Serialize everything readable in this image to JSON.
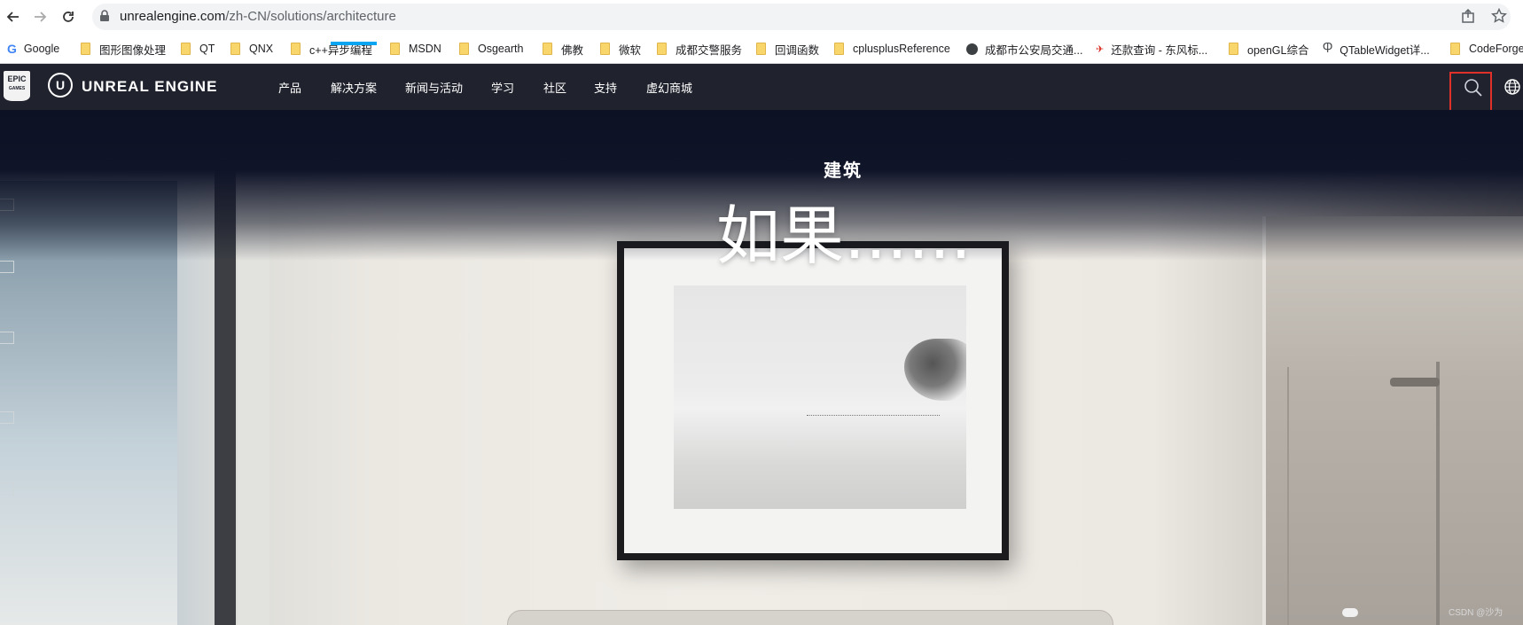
{
  "browser": {
    "url_host": "unrealengine.com",
    "url_path": "/zh-CN/solutions/architecture",
    "bookmarks": [
      {
        "label": "Google",
        "icon": "google-icon"
      },
      {
        "label": "图形图像处理",
        "icon": "folder-icon"
      },
      {
        "label": "QT",
        "icon": "folder-icon"
      },
      {
        "label": "QNX",
        "icon": "folder-icon"
      },
      {
        "label": "c++异步编程",
        "icon": "folder-icon"
      },
      {
        "label": "MSDN",
        "icon": "folder-icon"
      },
      {
        "label": "Osgearth",
        "icon": "folder-icon"
      },
      {
        "label": "佛教",
        "icon": "folder-icon"
      },
      {
        "label": "微软",
        "icon": "folder-icon"
      },
      {
        "label": "成都交警服务",
        "icon": "folder-icon"
      },
      {
        "label": "回调函数",
        "icon": "folder-icon"
      },
      {
        "label": "cplusplusReference",
        "icon": "folder-icon"
      },
      {
        "label": "成都市公安局交通...",
        "icon": "globe-icon"
      },
      {
        "label": "还款查询 - 东风标...",
        "icon": "brand-icon"
      },
      {
        "label": "openGL综合",
        "icon": "folder-icon"
      },
      {
        "label": "QTableWidget详...",
        "icon": "q-icon"
      },
      {
        "label": "CodeForge",
        "icon": "folder-icon"
      }
    ]
  },
  "site": {
    "epic_logo_text": "EPIC",
    "epic_logo_sub": "GAMES",
    "ue_logo_letter": "U",
    "brand": "UNREAL ENGINE",
    "nav": [
      {
        "label": "产品"
      },
      {
        "label": "解决方案"
      },
      {
        "label": "新闻与活动"
      },
      {
        "label": "学习"
      },
      {
        "label": "社区"
      },
      {
        "label": "支持"
      },
      {
        "label": "虚幻商城"
      }
    ],
    "active_nav": "解决方案",
    "accent_color": "#0aa5f0",
    "highlight_color": "#e0302a"
  },
  "hero": {
    "subtitle": "建筑",
    "title": "如果……"
  },
  "watermark": "CSDN @沙为"
}
